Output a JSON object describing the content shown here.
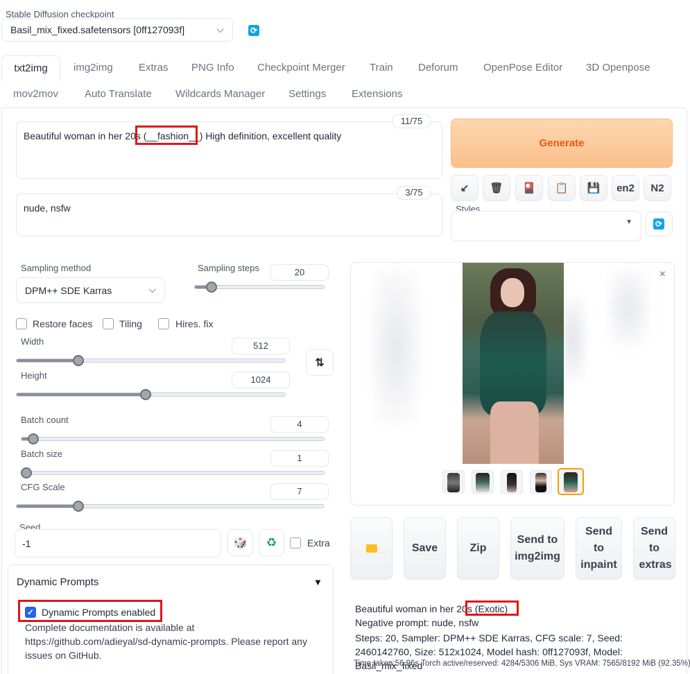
{
  "checkpoint": {
    "label": "Stable Diffusion checkpoint",
    "value": "Basil_mix_fixed.safetensors [0ff127093f]"
  },
  "tabs_row1": [
    "txt2img",
    "img2img",
    "Extras",
    "PNG Info",
    "Checkpoint Merger",
    "Train",
    "Deforum",
    "OpenPose Editor",
    "3D Openpose"
  ],
  "tabs_row2": [
    "mov2mov",
    "Auto Translate",
    "Wildcards Manager",
    "Settings",
    "Extensions"
  ],
  "prompt": {
    "text": "Beautiful woman in her 20s (__fashion__) High definition, excellent quality",
    "counter": "11/75"
  },
  "negative_prompt": {
    "text": "nude, nsfw",
    "counter": "3/75"
  },
  "generate_label": "Generate",
  "tool_buttons": [
    "↙",
    "🗑",
    "🎴",
    "📋",
    "💾",
    "en2",
    "N2"
  ],
  "styles_label": "Styles",
  "sampling": {
    "method_label": "Sampling method",
    "method_value": "DPM++ SDE Karras",
    "steps_label": "Sampling steps",
    "steps_value": "20",
    "steps_fraction": 0.13
  },
  "checkboxes": {
    "restore_faces": "Restore faces",
    "tiling": "Tiling",
    "hires_fix": "Hires. fix"
  },
  "width": {
    "label": "Width",
    "value": "512",
    "fraction": 0.23
  },
  "height": {
    "label": "Height",
    "value": "1024",
    "fraction": 0.48
  },
  "batch_count": {
    "label": "Batch count",
    "value": "4",
    "fraction": 0.04
  },
  "batch_size": {
    "label": "Batch size",
    "value": "1",
    "fraction": 0.0
  },
  "cfg_scale": {
    "label": "CFG Scale",
    "value": "7",
    "fraction": 0.2
  },
  "seed": {
    "label": "Seed",
    "value": "-1",
    "extra_label": "Extra"
  },
  "dynamic_prompts": {
    "title": "Dynamic Prompts",
    "enabled_label": "Dynamic Prompts enabled",
    "doc_text": "Complete documentation is available at https://github.com/adieyal/sd-dynamic-prompts. Please report any issues on GitHub."
  },
  "output_buttons": {
    "save": "Save",
    "zip": "Zip",
    "send_img2img": "Send to img2img",
    "send_inpaint": "Send to inpaint",
    "send_extras": "Send to extras"
  },
  "info": {
    "prompt_line_prefix": "Beautiful woman in her 20s",
    "prompt_line_highlight": "(Exotic)",
    "negative_line": "Negative prompt: nude, nsfw",
    "params_line": "Steps: 20, Sampler: DPM++ SDE Karras, CFG scale: 7, Seed: 2460142760, Size: 512x1024, Model hash: 0ff127093f, Model: Basil_mix_fixed",
    "time_line": "Time taken:56.96s  Torch active/reserved: 4284/5306 MiB, Sys VRAM: 7565/8192 MiB (92.35%)"
  },
  "colors": {
    "generate_bg": "#fcc89e",
    "generate_text": "#ea580c",
    "highlight_red": "#e0151b",
    "refresh_blue": "#0ea5e9"
  }
}
